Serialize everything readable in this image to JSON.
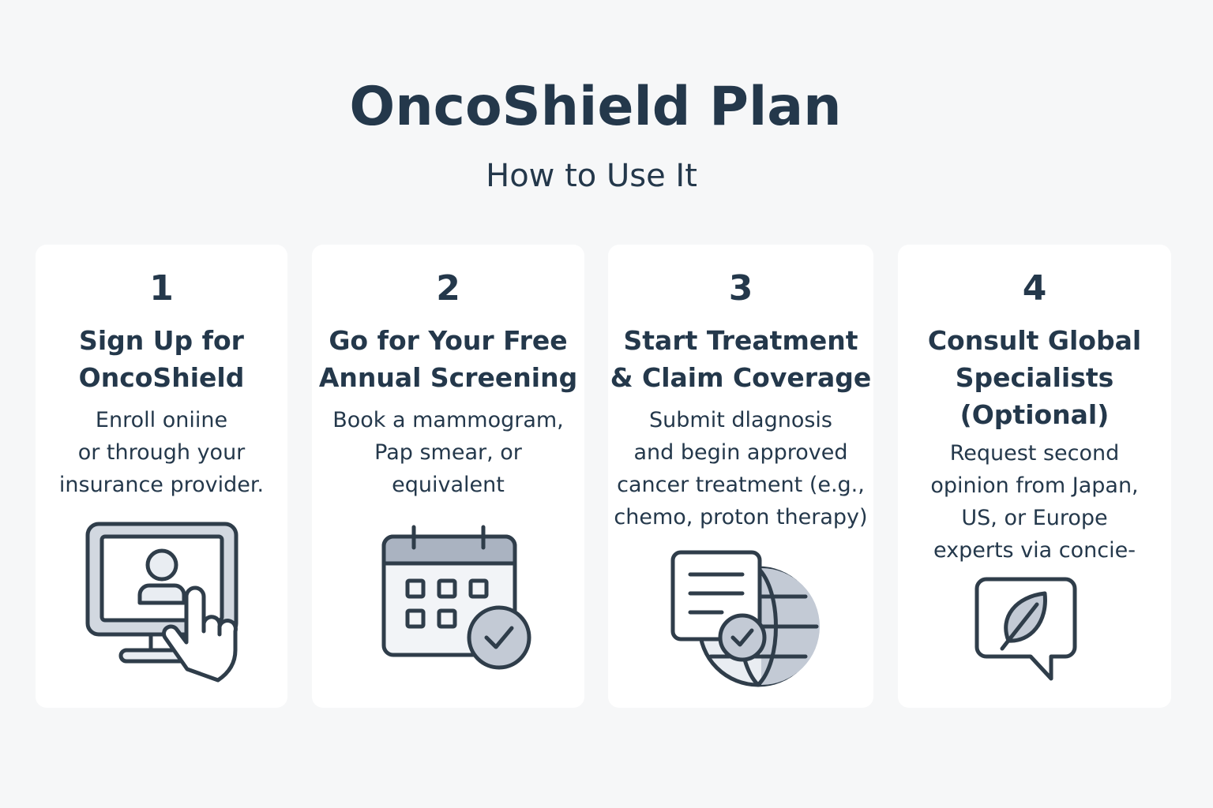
{
  "header": {
    "title": "OncoShield Plan",
    "subtitle": "How to Use It"
  },
  "steps": [
    {
      "number": "1",
      "heading": "Sign Up for\nOncoShield",
      "description": "Enroll oniine\nor through your\ninsurance provider.",
      "icon": "computer-click-icon"
    },
    {
      "number": "2",
      "heading": "Go for Your Free\nAnnual Screening",
      "description": "Book a mammogram,\nPap smear, or\nequivalent",
      "icon": "calendar-check-icon"
    },
    {
      "number": "3",
      "heading": "Start Treatment\n& Claim Coverage",
      "description": "Submit dlagnosis\nand begin approved\ncancer treatment (e.g.,\nchemo, proton therapy)",
      "icon": "document-globe-check-icon"
    },
    {
      "number": "4",
      "heading": "Consult Global\nSpecialists\n(Optional)",
      "description": "Request second\nopinion from Japan,\nUS, or Europe\nexperts via concie-",
      "icon": "chat-leaf-icon"
    }
  ],
  "colors": {
    "ink": "#24384b",
    "stroke": "#2f3d4a",
    "fill_light": "#e9edf2",
    "fill_mid": "#c3cad5",
    "card": "#ffffff",
    "background": "#f6f7f8"
  }
}
